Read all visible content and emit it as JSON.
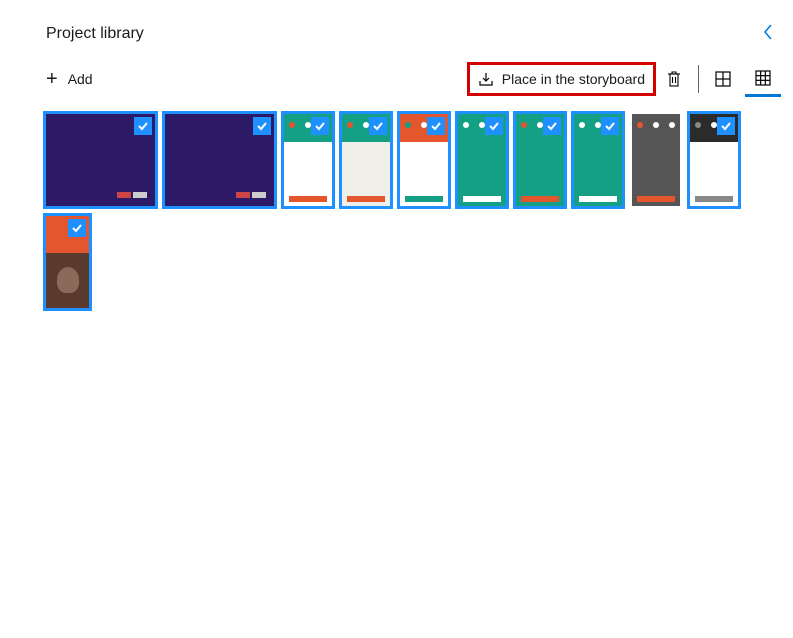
{
  "header": {
    "title": "Project library"
  },
  "toolbar": {
    "add_label": "Add",
    "place_label": "Place in the storyboard"
  },
  "icons": {
    "collapse": "chevron-left",
    "add": "plus",
    "place": "download-to-bar",
    "delete": "trash",
    "view_large": "grid-2x2",
    "view_small": "grid-3x3"
  },
  "view": {
    "active": "small"
  },
  "thumbnails": [
    {
      "id": 0,
      "kind": "wide",
      "selected": true,
      "bg": "#2d1a66"
    },
    {
      "id": 1,
      "kind": "wide",
      "selected": true,
      "bg": "#2d1a66"
    },
    {
      "id": 2,
      "kind": "tall",
      "selected": true,
      "top": "#14a085",
      "bot": "#ffffff",
      "accent": "#e4572e"
    },
    {
      "id": 3,
      "kind": "tall",
      "selected": true,
      "top": "#14a085",
      "bot": "#f0eee9",
      "accent": "#e4572e"
    },
    {
      "id": 4,
      "kind": "tall",
      "selected": true,
      "top": "#e4572e",
      "bot": "#ffffff",
      "accent": "#14a085"
    },
    {
      "id": 5,
      "kind": "tall",
      "selected": true,
      "top": "#14a085",
      "bot": "#14a085",
      "accent": "#ffffff"
    },
    {
      "id": 6,
      "kind": "tall",
      "selected": true,
      "top": "#14a085",
      "bot": "#14a085",
      "accent": "#e4572e"
    },
    {
      "id": 7,
      "kind": "tall",
      "selected": true,
      "top": "#14a085",
      "bot": "#14a085",
      "accent": "#ffffff"
    },
    {
      "id": 8,
      "kind": "tall",
      "selected": false,
      "top": "#555555",
      "bot": "#555555",
      "accent": "#e4572e"
    },
    {
      "id": 9,
      "kind": "tall",
      "selected": true,
      "top": "#2b2b2b",
      "bot": "#ffffff",
      "accent": "#888888"
    },
    {
      "id": 10,
      "kind": "vtall",
      "selected": true,
      "top": "#e4572e",
      "bot": "#5a3b2e",
      "accent": "#ffffff"
    }
  ]
}
